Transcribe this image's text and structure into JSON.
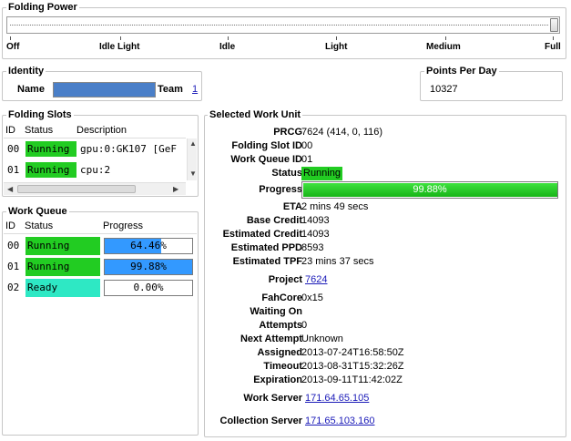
{
  "folding_power": {
    "title": "Folding Power",
    "levels": [
      "Off",
      "Idle Light",
      "Idle",
      "Light",
      "Medium",
      "Full"
    ],
    "selected": "Full"
  },
  "identity": {
    "title": "Identity",
    "name_label": "Name",
    "team_label": "Team",
    "team_value": "1"
  },
  "ppd": {
    "title": "Points Per Day",
    "value": "10327"
  },
  "folding_slots": {
    "title": "Folding Slots",
    "columns": [
      "ID",
      "Status",
      "Description"
    ],
    "rows": [
      {
        "id": "00",
        "status": "Running",
        "description": "gpu:0:GK107 [GeF"
      },
      {
        "id": "01",
        "status": "Running",
        "description": "cpu:2"
      }
    ]
  },
  "work_queue": {
    "title": "Work Queue",
    "columns": [
      "ID",
      "Status",
      "Progress"
    ],
    "rows": [
      {
        "id": "00",
        "status": "Running",
        "progress": "64.46%",
        "progress_fraction": 0.6446
      },
      {
        "id": "01",
        "status": "Running",
        "progress": "99.88%",
        "progress_fraction": 0.9988
      },
      {
        "id": "02",
        "status": "Ready",
        "progress": "0.00%",
        "progress_fraction": 0.0
      }
    ]
  },
  "work_unit": {
    "title": "Selected Work Unit",
    "prcg_label": "PRCG",
    "prcg": "7624 (414, 0, 116)",
    "slot_label": "Folding Slot ID",
    "slot": "00",
    "queue_label": "Work Queue ID",
    "queue": "01",
    "status_label": "Status",
    "status": "Running",
    "progress_label": "Progress",
    "progress": "99.88%",
    "progress_fraction": 0.9988,
    "eta_label": "ETA",
    "eta": "2 mins 49 secs",
    "base_credit_label": "Base Credit",
    "base_credit": "14093",
    "est_credit_label": "Estimated Credit",
    "est_credit": "14093",
    "est_ppd_label": "Estimated PPD",
    "est_ppd": "8593",
    "est_tpf_label": "Estimated TPF",
    "est_tpf": "23 mins 37 secs",
    "project_label": "Project",
    "project": "7624",
    "fahcore_label": "FahCore",
    "fahcore": "0x15",
    "waiting_label": "Waiting On",
    "waiting": "",
    "attempts_label": "Attempts",
    "attempts": "0",
    "next_attempt_label": "Next Attempt",
    "next_attempt": "Unknown",
    "assigned_label": "Assigned",
    "assigned": "2013-07-24T16:58:50Z",
    "timeout_label": "Timeout",
    "timeout": "2013-08-31T15:32:26Z",
    "expiration_label": "Expiration",
    "expiration": "2013-09-11T11:42:02Z",
    "work_server_label": "Work Server",
    "work_server": "171.64.65.105",
    "collection_server_label": "Collection Server",
    "collection_server": "171.65.103.160"
  },
  "colors": {
    "running": "#22cc22",
    "ready": "#2ee8c4",
    "progress_blue": "#3399ff",
    "progress_green": "#22cc22",
    "link": "#1a1ab8"
  }
}
